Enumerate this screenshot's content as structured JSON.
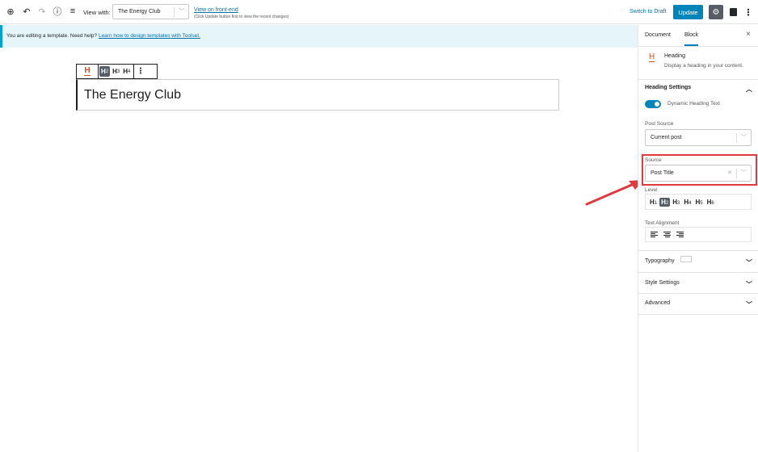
{
  "toolbar": {
    "view_with_label": "View with:",
    "view_with_value": "The Energy Club",
    "view_frontend_link": "View on front-end",
    "view_frontend_note": "(Click Update button first to view the recent changes)",
    "switch_to_draft": "Switch to Draft",
    "update_label": "Update",
    "icons": [
      "add-block-icon",
      "undo-icon",
      "redo-icon",
      "info-icon",
      "list-view-icon",
      "gear-icon",
      "toolset-icon",
      "more-options-icon"
    ]
  },
  "notice": {
    "text": "You are editing a template. Need help? ",
    "link": "Learn how to design templates with Toolset."
  },
  "editor": {
    "block_toolbar": {
      "levels": [
        {
          "h": "H",
          "n": "2"
        },
        {
          "h": "H",
          "n": "3"
        },
        {
          "h": "H",
          "n": "4"
        }
      ],
      "active_level": "2"
    },
    "heading_text": "The Energy Club"
  },
  "sidebar": {
    "tabs": [
      "Document",
      "Block"
    ],
    "active_tab": "Block",
    "close": "×",
    "block_card": {
      "title": "Heading",
      "description": "Display a heading in your content."
    },
    "heading_settings": {
      "title": "Heading Settings",
      "toggle_label": "Dynamic Heading Text",
      "toggle_on": true,
      "post_source_label": "Post Source",
      "post_source_value": "Current post",
      "source_label": "Source",
      "source_value": "Post Title",
      "level_label": "Level",
      "levels": [
        {
          "h": "H",
          "n": "1"
        },
        {
          "h": "H",
          "n": "2"
        },
        {
          "h": "H",
          "n": "3"
        },
        {
          "h": "H",
          "n": "4"
        },
        {
          "h": "H",
          "n": "5"
        },
        {
          "h": "H",
          "n": "6"
        }
      ],
      "active_level": "2",
      "text_alignment_label": "Text Alignment"
    },
    "panels": [
      "Typography",
      "Style Settings",
      "Advanced"
    ]
  },
  "colors": {
    "accent": "#0085ba",
    "highlight": "#e0393e",
    "heading_icon": "#d54e21"
  }
}
